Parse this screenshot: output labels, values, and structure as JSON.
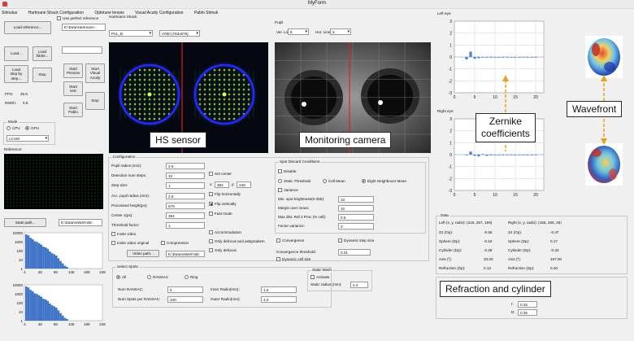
{
  "window": {
    "title": "MyForm"
  },
  "menu": [
    "Stimulus",
    "Hartmann Shack Configuration",
    "Optotune lenses",
    "Visual Acuity Configuration",
    "Pablo Stimuli"
  ],
  "left": {
    "load_reference": "Load reference...",
    "use_perfect_reference": "Use perfect reference",
    "reference_path": "E:\\Data\\Hartmann-",
    "load": "Load...",
    "load_folder": "Load\nfolder...",
    "load_step": "Load\nstep by\nstep...",
    "step": "Step",
    "start_preview": "Start\nPreview",
    "start_test": "Start\ntest",
    "start_pablo": "Start\nPablo",
    "start_visual_acuity": "Start\nVisual\nAcuity",
    "stop": "Stop",
    "fps_label": "FPS:",
    "fps_value": "25.6",
    "rms_label": "RMSh:",
    "rms_value": "0.5",
    "mode_title": "Mode",
    "cpu": "CPU",
    "gpu": "GPU",
    "mode_select": "LCUM",
    "reference_title": "Reference:",
    "stats_path": "Stats path...",
    "stats_path_value": "E:\\Data\\VaNsFoldc"
  },
  "hist": {
    "y_ticks": [
      "10000",
      "1000",
      "100",
      "10",
      "1"
    ],
    "x_ticks": [
      "-1",
      "48",
      "98",
      "149",
      "199",
      "249"
    ],
    "bars": [
      1,
      0.97,
      0.9,
      0.86,
      0.8,
      0.78,
      0.74,
      0.7,
      0.64,
      0.62,
      0.58,
      0.5,
      0.45,
      0.42,
      0.38,
      0.3,
      0.22,
      0.15,
      0.08,
      0.05
    ]
  },
  "hs": {
    "title": "Hartmann-Shack",
    "lenslet_select": "PAL_B",
    "resolution_select": "V000 (763x576)",
    "caption": "HS sensor"
  },
  "pupil": {
    "title": "Pupil",
    "ver_lines_label": "Ver. Lines",
    "ver_lines_value": "6",
    "hor_lines_label": "Hor. Lines",
    "hor_lines_value": "6",
    "caption": "Monitoring camera"
  },
  "config": {
    "title": "Configuration",
    "fields": [
      {
        "label": "Pupil radius (mm):",
        "value": "2.5"
      },
      {
        "label": "Detection num steps:",
        "value": "10"
      },
      {
        "label": "Step size:",
        "value": "1"
      },
      {
        "label": "Acc. pupil radius (mm):",
        "value": "2.5"
      },
      {
        "label": "Processed height(px):",
        "value": "576"
      },
      {
        "label": "Center x(px):",
        "value": "384"
      },
      {
        "label": "Threshold factor:",
        "value": "1"
      }
    ],
    "set_center": "Set center",
    "x_label": "x:",
    "x_value": "384",
    "y_label": "y:",
    "y_value": "240",
    "flip_h": "Flip horizontally",
    "flip_v": "Flip vertically",
    "fast_mode": "Fast mode",
    "invite_video": "Invite video",
    "invite_video_original": "Invite video original",
    "compression": "Compression",
    "video_path": "Video path...",
    "video_path_value": "E:\\Data\\VaNsFoldc",
    "accommodation": "Accommodation",
    "only_defocus_astig": "Only defocus and astigmatism",
    "only_defocus": "Only defocus",
    "convergence": "Convergence",
    "dynamic_step_size": "Dynamic step size",
    "convergence_threshold": "Convergence threshold:",
    "convergence_threshold_value": "0.01",
    "dynamic_cell_size": "Dynamic cell size"
  },
  "spot_discard": {
    "title": "Spot Discard Conditions",
    "disable": "Disable",
    "static_threshold": "Static Threshold",
    "cell_mean": "Cell Mean",
    "eight_neighbours": "Eight Neighbours Mean",
    "variance": "Variance",
    "min_spot_label": "Min. spot brightness(0-255):",
    "min_spot_value": "10",
    "margin_label": "Margin over mean:",
    "margin_value": "10",
    "max_dist_label": "Max dist. Ref 2 Proc (% cell):",
    "max_dist_value": "0.5",
    "factor_label": "Factor variance:",
    "factor_value": "3"
  },
  "select_spots": {
    "title": "Select Spots",
    "all": "All",
    "ransac": "RANSAC",
    "ring": "Ring",
    "num_ransac_label": "Num RANSAC:",
    "num_ransac_value": "5",
    "num_spots_label": "Num Spots per RANSAC:",
    "num_spots_value": "100",
    "inner_label": "Inner Radio(mm):",
    "inner_value": "1.5",
    "outer_label": "Outer Radio(mm):",
    "outer_value": "4.0"
  },
  "static_mesh": {
    "title": "Static Mesh",
    "activate": "Activate",
    "static_radius_label": "Static radius (mm):",
    "static_radius_value": "2.0"
  },
  "charts": {
    "left_title": "Left eye:",
    "right_title": "Right eye:",
    "y_ticks": [
      "3",
      "2",
      "1",
      "0",
      "-1",
      "-2",
      "-3"
    ],
    "x_ticks": [
      "0",
      "5",
      "10",
      "15",
      "20"
    ]
  },
  "chart_data": [
    {
      "type": "bar",
      "title": "Left eye:",
      "x": [
        3,
        4,
        5,
        6,
        7,
        8,
        9,
        10,
        11,
        12,
        13,
        14,
        15,
        16,
        17,
        18,
        19,
        20
      ],
      "values": [
        -0.2,
        0.45,
        -0.15,
        -0.1,
        0,
        -0.05,
        -0.05,
        0,
        -0.05,
        -0.05,
        0,
        -0.05,
        0,
        0,
        0,
        -0.05,
        0,
        0
      ],
      "ylim": [
        -3,
        3
      ],
      "xlim": [
        0,
        22
      ]
    },
    {
      "type": "bar",
      "title": "Right eye:",
      "x": [
        3,
        4,
        5,
        6,
        7,
        8,
        9,
        10,
        11,
        12,
        13,
        14,
        15,
        16,
        17,
        18,
        19,
        20
      ],
      "values": [
        -0.05,
        0.25,
        -0.1,
        -0.15,
        0.05,
        -0.1,
        -0.05,
        0,
        -0.05,
        0,
        -0.05,
        0,
        0,
        0,
        -0.05,
        0,
        0,
        0
      ],
      "ylim": [
        -3,
        3
      ],
      "xlim": [
        0,
        22
      ]
    }
  ],
  "data_panel": {
    "title": "Data",
    "left_header": "Left (x, y, radio): (216, 257, 159)",
    "right_header": "Right (x, y, radio): (155, 260, 46)",
    "rows": [
      {
        "label": "Z4 (Op):",
        "left": "-0.56",
        "right_label": "Z4 (Op):",
        "right": "-0.47"
      },
      {
        "label": "Sphere (Dp):",
        "left": "-0.16",
        "right_label": "Sphere (Dp):",
        "right": "0.17"
      },
      {
        "label": "Cylinder (Dp):",
        "left": "-0.28",
        "right_label": "Cylinder (Dp):",
        "right": "-0.33"
      },
      {
        "label": "Axis (º):",
        "left": "33.00",
        "right_label": "Axis (º):",
        "right": "167.00"
      },
      {
        "label": "Refraction (Dp):",
        "left": "0.13",
        "right_label": "Refraction (Dp):",
        "right": "0.40"
      }
    ],
    "i_label": "I:",
    "i_value": "0.25",
    "d_label": "D:",
    "d_value": "0.35"
  },
  "annotations": {
    "zernike": "Zernike\ncoefficients",
    "wavefront": "Wavefront",
    "refraction": "Refraction and cylinder"
  },
  "colors": {
    "hs_green": "#7fd21f",
    "hs_blue": "#1a2aff",
    "red_line": "#e02020",
    "bar_blue": "#4b7fd6",
    "arrow": "#e8a317"
  }
}
